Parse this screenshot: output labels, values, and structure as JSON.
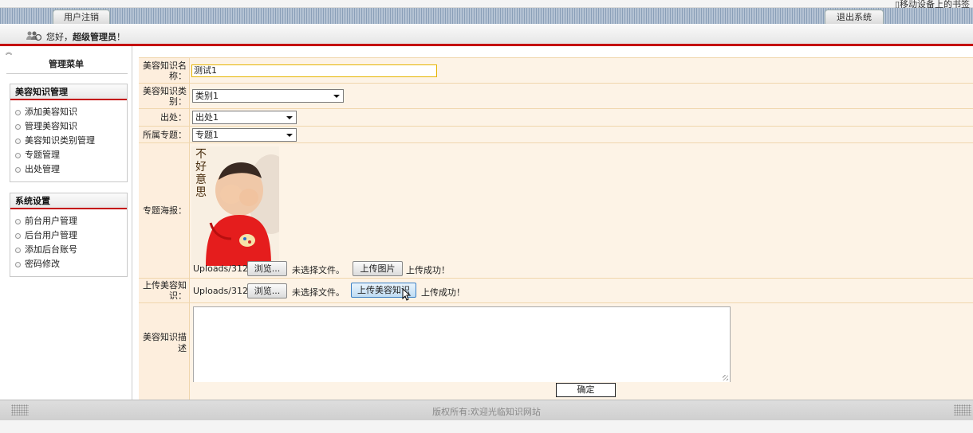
{
  "top": {
    "mobile_text": "移动设备上的书签"
  },
  "tabs": {
    "logout": "用户注销",
    "exit": "退出系统"
  },
  "welcome": {
    "greeting": "您好，",
    "username": "超级管理员",
    "suffix": "！"
  },
  "sidebar": {
    "title": "管理菜单",
    "groups": [
      {
        "title": "美容知识管理",
        "items": [
          "添加美容知识",
          "管理美容知识",
          "美容知识类别管理",
          "专题管理",
          "出处管理"
        ]
      },
      {
        "title": "系统设置",
        "items": [
          "前台用户管理",
          "后台用户管理",
          "添加后台账号",
          "密码修改"
        ]
      }
    ]
  },
  "form": {
    "name_label": "美容知识名称：",
    "name_value": "测试1",
    "category_label": "美容知识类别：",
    "category_value": "类别1",
    "source_label": "出处：",
    "source_value": "出处1",
    "topic_label": "所属专题：",
    "topic_value": "专题1",
    "poster_label": "专题海报：",
    "poster_caption": "不好意思",
    "poster_path": "Uploads/3121",
    "browse_label": "浏览...",
    "no_file_text": "未选择文件。",
    "upload_image_label": "上传图片",
    "upload_success": "上传成功！",
    "upload_knowledge_label": "上传美容知识：",
    "knowledge_path": "Uploads/3121",
    "upload_knowledge_button": "上传美容知识",
    "description_label": "美容知识描述",
    "description_value": "",
    "submit_label": "确定"
  },
  "footer": {
    "copyright": "版权所有:欢迎光临知识网站"
  },
  "colors": {
    "accent_red": "#c40000",
    "label_bg": "#fdeedd",
    "value_bg": "#fdf3e6",
    "border": "#f0d6ad"
  }
}
